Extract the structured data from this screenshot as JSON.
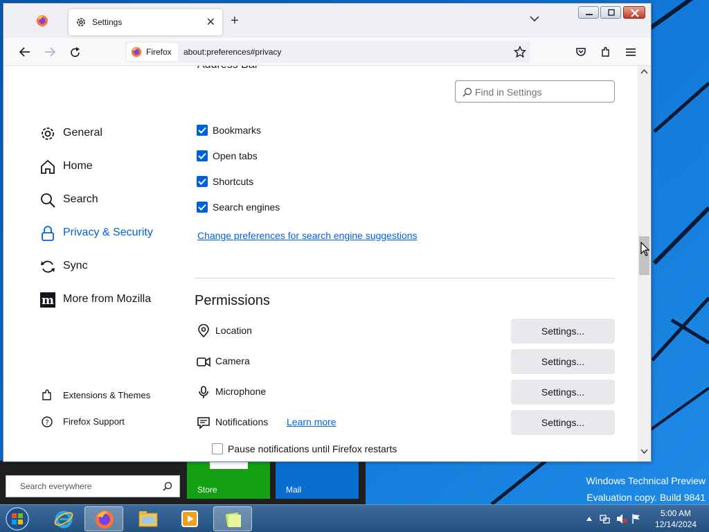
{
  "desktop": {
    "watermark_line1": "Windows Technical Preview",
    "watermark_line2": "Evaluation copy. Build 9841"
  },
  "start_menu": {
    "search_placeholder": "Search everywhere",
    "tiles": [
      {
        "label": "Store",
        "color": "#14a012"
      },
      {
        "label": "Mail",
        "color": "#0a6ed1"
      }
    ]
  },
  "taskbar": {
    "apps": [
      "internet-explorer",
      "firefox",
      "file-explorer",
      "media-player",
      "notes"
    ],
    "clock_time": "5:00 AM",
    "clock_date": "12/14/2024"
  },
  "browser": {
    "tab_title": "Settings",
    "url_identity": "Firefox",
    "url": "about:preferences#privacy"
  },
  "settings": {
    "search_placeholder": "Find in Settings",
    "categories": [
      {
        "label": "General",
        "icon": "gear-icon",
        "selected": false
      },
      {
        "label": "Home",
        "icon": "home-icon",
        "selected": false
      },
      {
        "label": "Search",
        "icon": "search-icon",
        "selected": false
      },
      {
        "label": "Privacy & Security",
        "icon": "lock-icon",
        "selected": true
      },
      {
        "label": "Sync",
        "icon": "sync-icon",
        "selected": false
      },
      {
        "label": "More from Mozilla",
        "icon": "mozilla-icon",
        "selected": false
      }
    ],
    "footer_links": [
      {
        "label": "Extensions & Themes",
        "icon": "puzzle-icon"
      },
      {
        "label": "Firefox Support",
        "icon": "help-icon"
      }
    ],
    "address_bar_heading": "Address Bar",
    "suggestion_checkboxes": [
      {
        "label": "Bookmarks",
        "checked": true
      },
      {
        "label": "Open tabs",
        "checked": true
      },
      {
        "label": "Shortcuts",
        "checked": true
      },
      {
        "label": "Search engines",
        "checked": true
      }
    ],
    "search_suggestions_link": "Change preferences for search engine suggestions",
    "permissions_title": "Permissions",
    "permissions": [
      {
        "label": "Location",
        "icon": "location-icon",
        "button": "Settings..."
      },
      {
        "label": "Camera",
        "icon": "camera-icon",
        "button": "Settings..."
      },
      {
        "label": "Microphone",
        "icon": "microphone-icon",
        "button": "Settings..."
      },
      {
        "label": "Notifications",
        "icon": "notification-icon",
        "button": "Settings...",
        "link": "Learn more"
      }
    ],
    "pause_notifications": {
      "label": "Pause notifications until Firefox restarts",
      "checked": false
    }
  },
  "colors": {
    "accent": "#0061e0",
    "desktop": "#0e74d4",
    "button_bg": "#e9e9ed"
  }
}
